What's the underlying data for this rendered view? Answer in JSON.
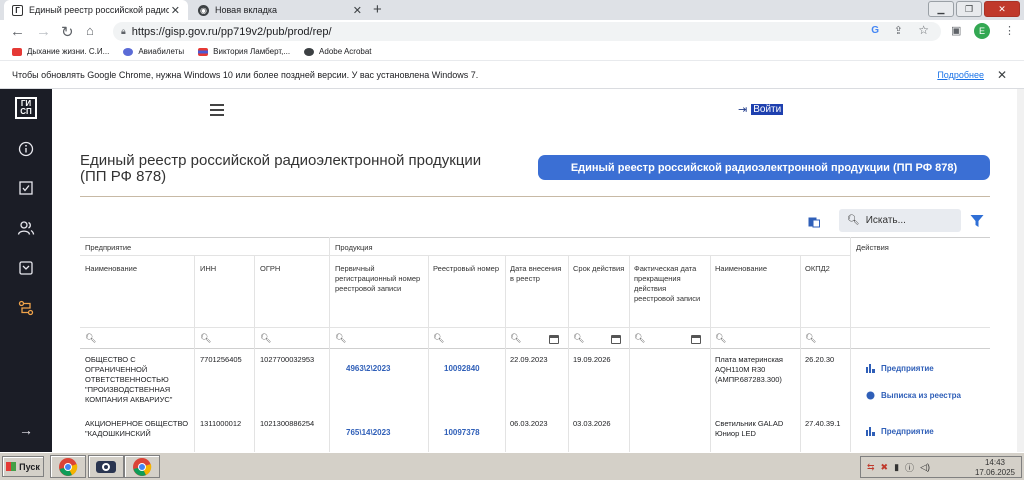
{
  "browser": {
    "tabs": [
      {
        "title": "Единый реестр российской радиоэ",
        "active": true
      },
      {
        "title": "Новая вкладка",
        "active": false
      }
    ],
    "url": "https://gisp.gov.ru/pp719v2/pub/prod/rep/",
    "bookmarks": [
      {
        "label": "Дыхание жизни. С.И...",
        "color": "#e53935"
      },
      {
        "label": "Авиабилеты",
        "color": "#5b6bd6"
      },
      {
        "label": "Виктория Ламберт,...",
        "color": "#4a5bd6"
      },
      {
        "label": "Adobe Acrobat",
        "color": "#3c4043"
      }
    ],
    "profile_initial": "E",
    "infobar": {
      "message": "Чтобы обновлять Google Chrome, нужна Windows 10 или более поздней версии. У вас установлена Windows 7.",
      "link": "Подробнее"
    }
  },
  "app": {
    "logo_lines": [
      "ГИ",
      "СП"
    ],
    "login_label": "Войти",
    "page_title": "Единый реестр российской радиоэлектронной продукции (ПП РФ 878)",
    "page_button": "Единый реестр российской радиоэлектронной продукции (ПП РФ 878)",
    "search_placeholder": "Искать..."
  },
  "table": {
    "group_headers": {
      "enterprise": "Предприятие",
      "product": "Продукция",
      "actions": "Действия"
    },
    "columns": [
      "Наименование",
      "ИНН",
      "ОГРН",
      "Первичный регистрационный номер реестровой записи",
      "Реестровый номер",
      "Дата внесения в реестр",
      "Срок действия",
      "Фактическая дата прекращения действия реестровой записи",
      "Наименование",
      "ОКПД2"
    ],
    "rows": [
      {
        "name": "ОБЩЕСТВО С ОГРАНИЧЕННОЙ ОТВЕТСТВЕННОСТЬЮ \"ПРОИЗВОДСТВЕННАЯ КОМПАНИЯ АКВАРИУС\"",
        "inn": "7701256405",
        "ogrn": "1027700032953",
        "primary_no": "4963\\2\\2023",
        "reg_no": "10092840",
        "date_in": "22.09.2023",
        "valid_until": "19.09.2026",
        "date_end": "",
        "product": "Плата материнская AQH110M R30 (АМПР.687283.300)",
        "okpd": "26.20.30"
      },
      {
        "name": "АКЦИОНЕРНОЕ ОБЩЕСТВО \"КАДОШКИНСКИЙ",
        "inn": "1311000012",
        "ogrn": "1021300886254",
        "primary_no": "765\\14\\2023",
        "reg_no": "10097378",
        "date_in": "06.03.2023",
        "valid_until": "03.03.2026",
        "date_end": "",
        "product": "Светильник GALAD Юниор LED",
        "okpd": "27.40.39.1"
      }
    ],
    "actions": {
      "enterprise": "Предприятие",
      "extract": "Выписка из реестра"
    }
  },
  "taskbar": {
    "start": "Пуск",
    "time": "14:43",
    "date": "17.06.2025"
  }
}
